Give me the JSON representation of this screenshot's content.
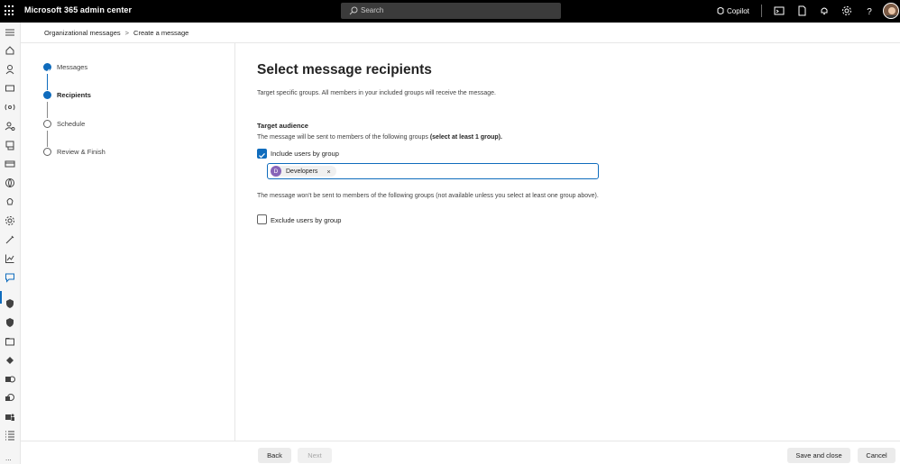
{
  "topbar": {
    "title": "Microsoft 365 admin center",
    "search_placeholder": "Search",
    "copilot_label": "Copilot",
    "icons": [
      "app-launcher-icon",
      "terminal-icon",
      "document-icon",
      "bell-icon",
      "gear-icon",
      "help-icon",
      "user-avatar"
    ]
  },
  "breadcrumb": {
    "items": [
      "Organizational messages",
      "Create a message"
    ],
    "separator": ">"
  },
  "steps": [
    {
      "label": "Messages",
      "state": "done"
    },
    {
      "label": "Recipients",
      "state": "current"
    },
    {
      "label": "Schedule",
      "state": "todo"
    },
    {
      "label": "Review & Finish",
      "state": "todo"
    }
  ],
  "main": {
    "title": "Select message recipients",
    "description": "Target specific groups. All members in your included groups will receive the message.",
    "target_audience": {
      "title": "Target audience",
      "description": "The message will be sent to members of the following groups",
      "description_bold": "(select at least 1 group)."
    },
    "include": {
      "label": "Include users by group",
      "checked": true,
      "selected_group": {
        "initial": "D",
        "name": "Developers",
        "remove": "×"
      }
    },
    "exclude": {
      "note": "The message won't be sent to members of the following groups (not available unless you select at least one group above).",
      "label": "Exclude users by group",
      "checked": false
    }
  },
  "footer": {
    "back": "Back",
    "next": "Next",
    "save_close": "Save and close",
    "cancel": "Cancel"
  },
  "rail": {
    "more": "..."
  },
  "colors": {
    "accent": "#0f6cbd",
    "topbar": "#000000",
    "chip_avatar": "#8764b8"
  }
}
